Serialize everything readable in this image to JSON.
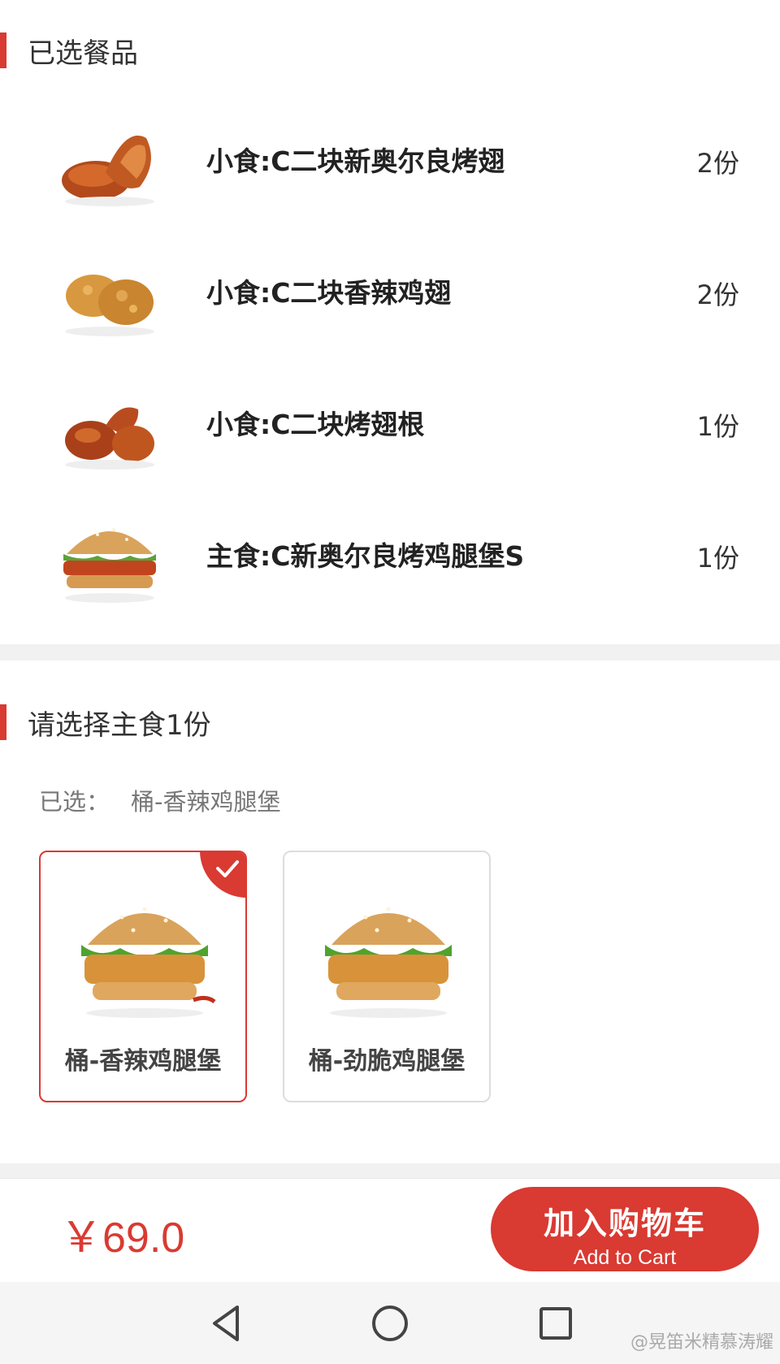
{
  "selected_section": {
    "title": "已选餐品",
    "items": [
      {
        "name": "小食:C二块新奥尔良烤翅",
        "qty": "2份",
        "icon": "grilled-wings-icon"
      },
      {
        "name": "小食:C二块香辣鸡翅",
        "qty": "2份",
        "icon": "fried-wings-icon"
      },
      {
        "name": "小食:C二块烤翅根",
        "qty": "1份",
        "icon": "drumettes-icon"
      },
      {
        "name": "主食:C新奥尔良烤鸡腿堡S",
        "qty": "1份",
        "icon": "chicken-burger-icon"
      }
    ]
  },
  "choose_section": {
    "title": "请选择主食1份",
    "selected_label": "已选：",
    "selected_value": "桶-香辣鸡腿堡",
    "options": [
      {
        "label": "桶-香辣鸡腿堡",
        "selected": true
      },
      {
        "label": "桶-劲脆鸡腿堡",
        "selected": false
      }
    ]
  },
  "footer": {
    "price": "￥69.0",
    "cart_button": {
      "label": "加入购物车",
      "sublabel": "Add to Cart"
    }
  },
  "nav": {
    "back_icon": "back-triangle-icon",
    "home_icon": "home-circle-icon",
    "recents_icon": "recents-square-icon",
    "watermark": "@晃笛米精慕涛耀"
  },
  "colors": {
    "accent": "#d93a32",
    "divider": "#f1f1f1"
  }
}
